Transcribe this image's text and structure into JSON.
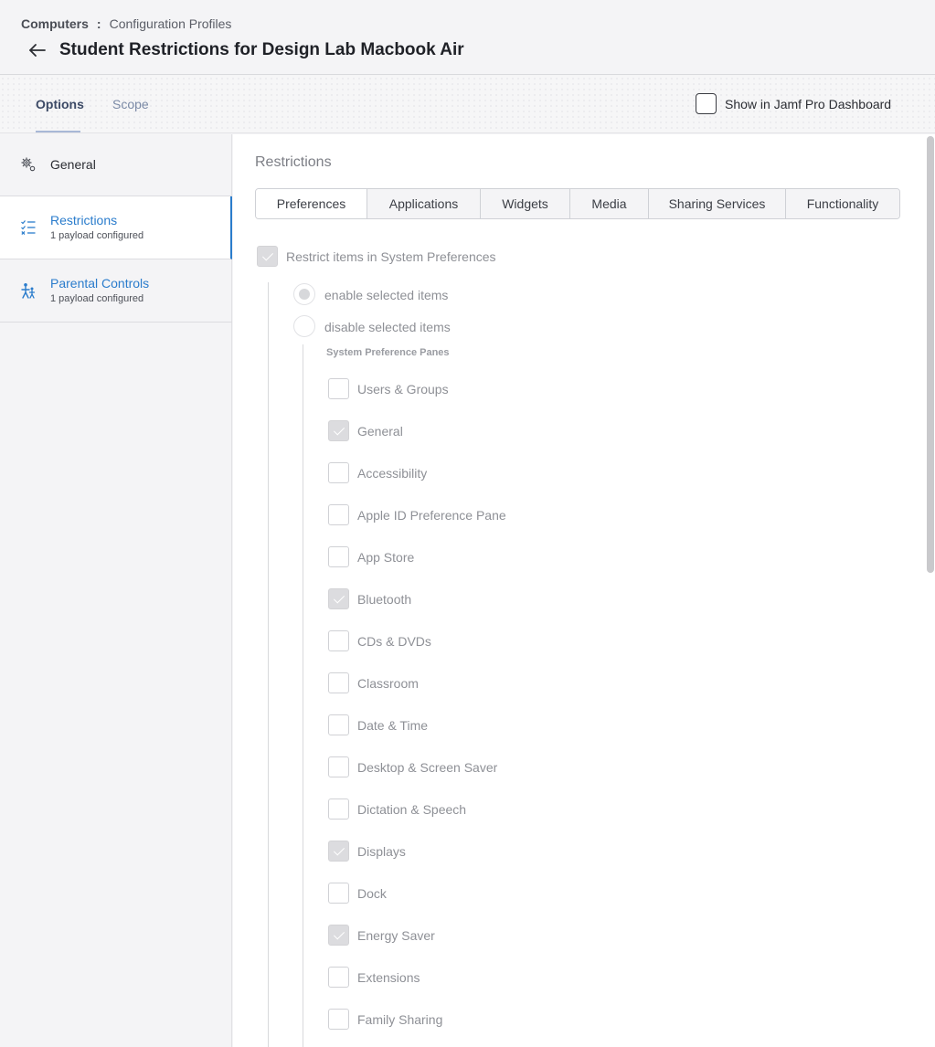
{
  "header": {
    "breadcrumb_root": "Computers",
    "breadcrumb_separator": ":",
    "breadcrumb_current": "Configuration Profiles",
    "title": "Student Restrictions for Design Lab Macbook Air"
  },
  "top_tabs": {
    "options": "Options",
    "scope": "Scope",
    "active": "Options"
  },
  "dashboard_toggle": {
    "label": "Show in Jamf Pro Dashboard",
    "checked": false
  },
  "sidebar": {
    "items": [
      {
        "label": "General",
        "sub": "",
        "icon": "gear-icon",
        "selected": false
      },
      {
        "label": "Restrictions",
        "sub": "1 payload configured",
        "icon": "checklist-icon",
        "selected": true
      },
      {
        "label": "Parental Controls",
        "sub": "1 payload configured",
        "icon": "family-icon",
        "selected": false
      }
    ]
  },
  "main": {
    "section_title": "Restrictions",
    "subtabs": [
      "Preferences",
      "Applications",
      "Widgets",
      "Media",
      "Sharing Services",
      "Functionality"
    ],
    "active_subtab": "Preferences",
    "restrict_label": "Restrict items in System Preferences",
    "restrict_checked": true,
    "radio_enable": "enable selected items",
    "radio_disable": "disable selected items",
    "radio_selected": "enable selected items",
    "panes_heading": "System Preference Panes",
    "panes": [
      {
        "label": "Users & Groups",
        "checked": false
      },
      {
        "label": "General",
        "checked": true
      },
      {
        "label": "Accessibility",
        "checked": false
      },
      {
        "label": "Apple ID Preference Pane",
        "checked": false
      },
      {
        "label": "App Store",
        "checked": false
      },
      {
        "label": "Bluetooth",
        "checked": true
      },
      {
        "label": "CDs & DVDs",
        "checked": false
      },
      {
        "label": "Classroom",
        "checked": false
      },
      {
        "label": "Date & Time",
        "checked": false
      },
      {
        "label": "Desktop & Screen Saver",
        "checked": false
      },
      {
        "label": "Dictation & Speech",
        "checked": false
      },
      {
        "label": "Displays",
        "checked": true
      },
      {
        "label": "Dock",
        "checked": false
      },
      {
        "label": "Energy Saver",
        "checked": true
      },
      {
        "label": "Extensions",
        "checked": false
      },
      {
        "label": "Family Sharing",
        "checked": false
      }
    ]
  },
  "colors": {
    "accent": "#2a7ccc",
    "muted_text": "#8e9096",
    "background": "#f4f4f6"
  }
}
